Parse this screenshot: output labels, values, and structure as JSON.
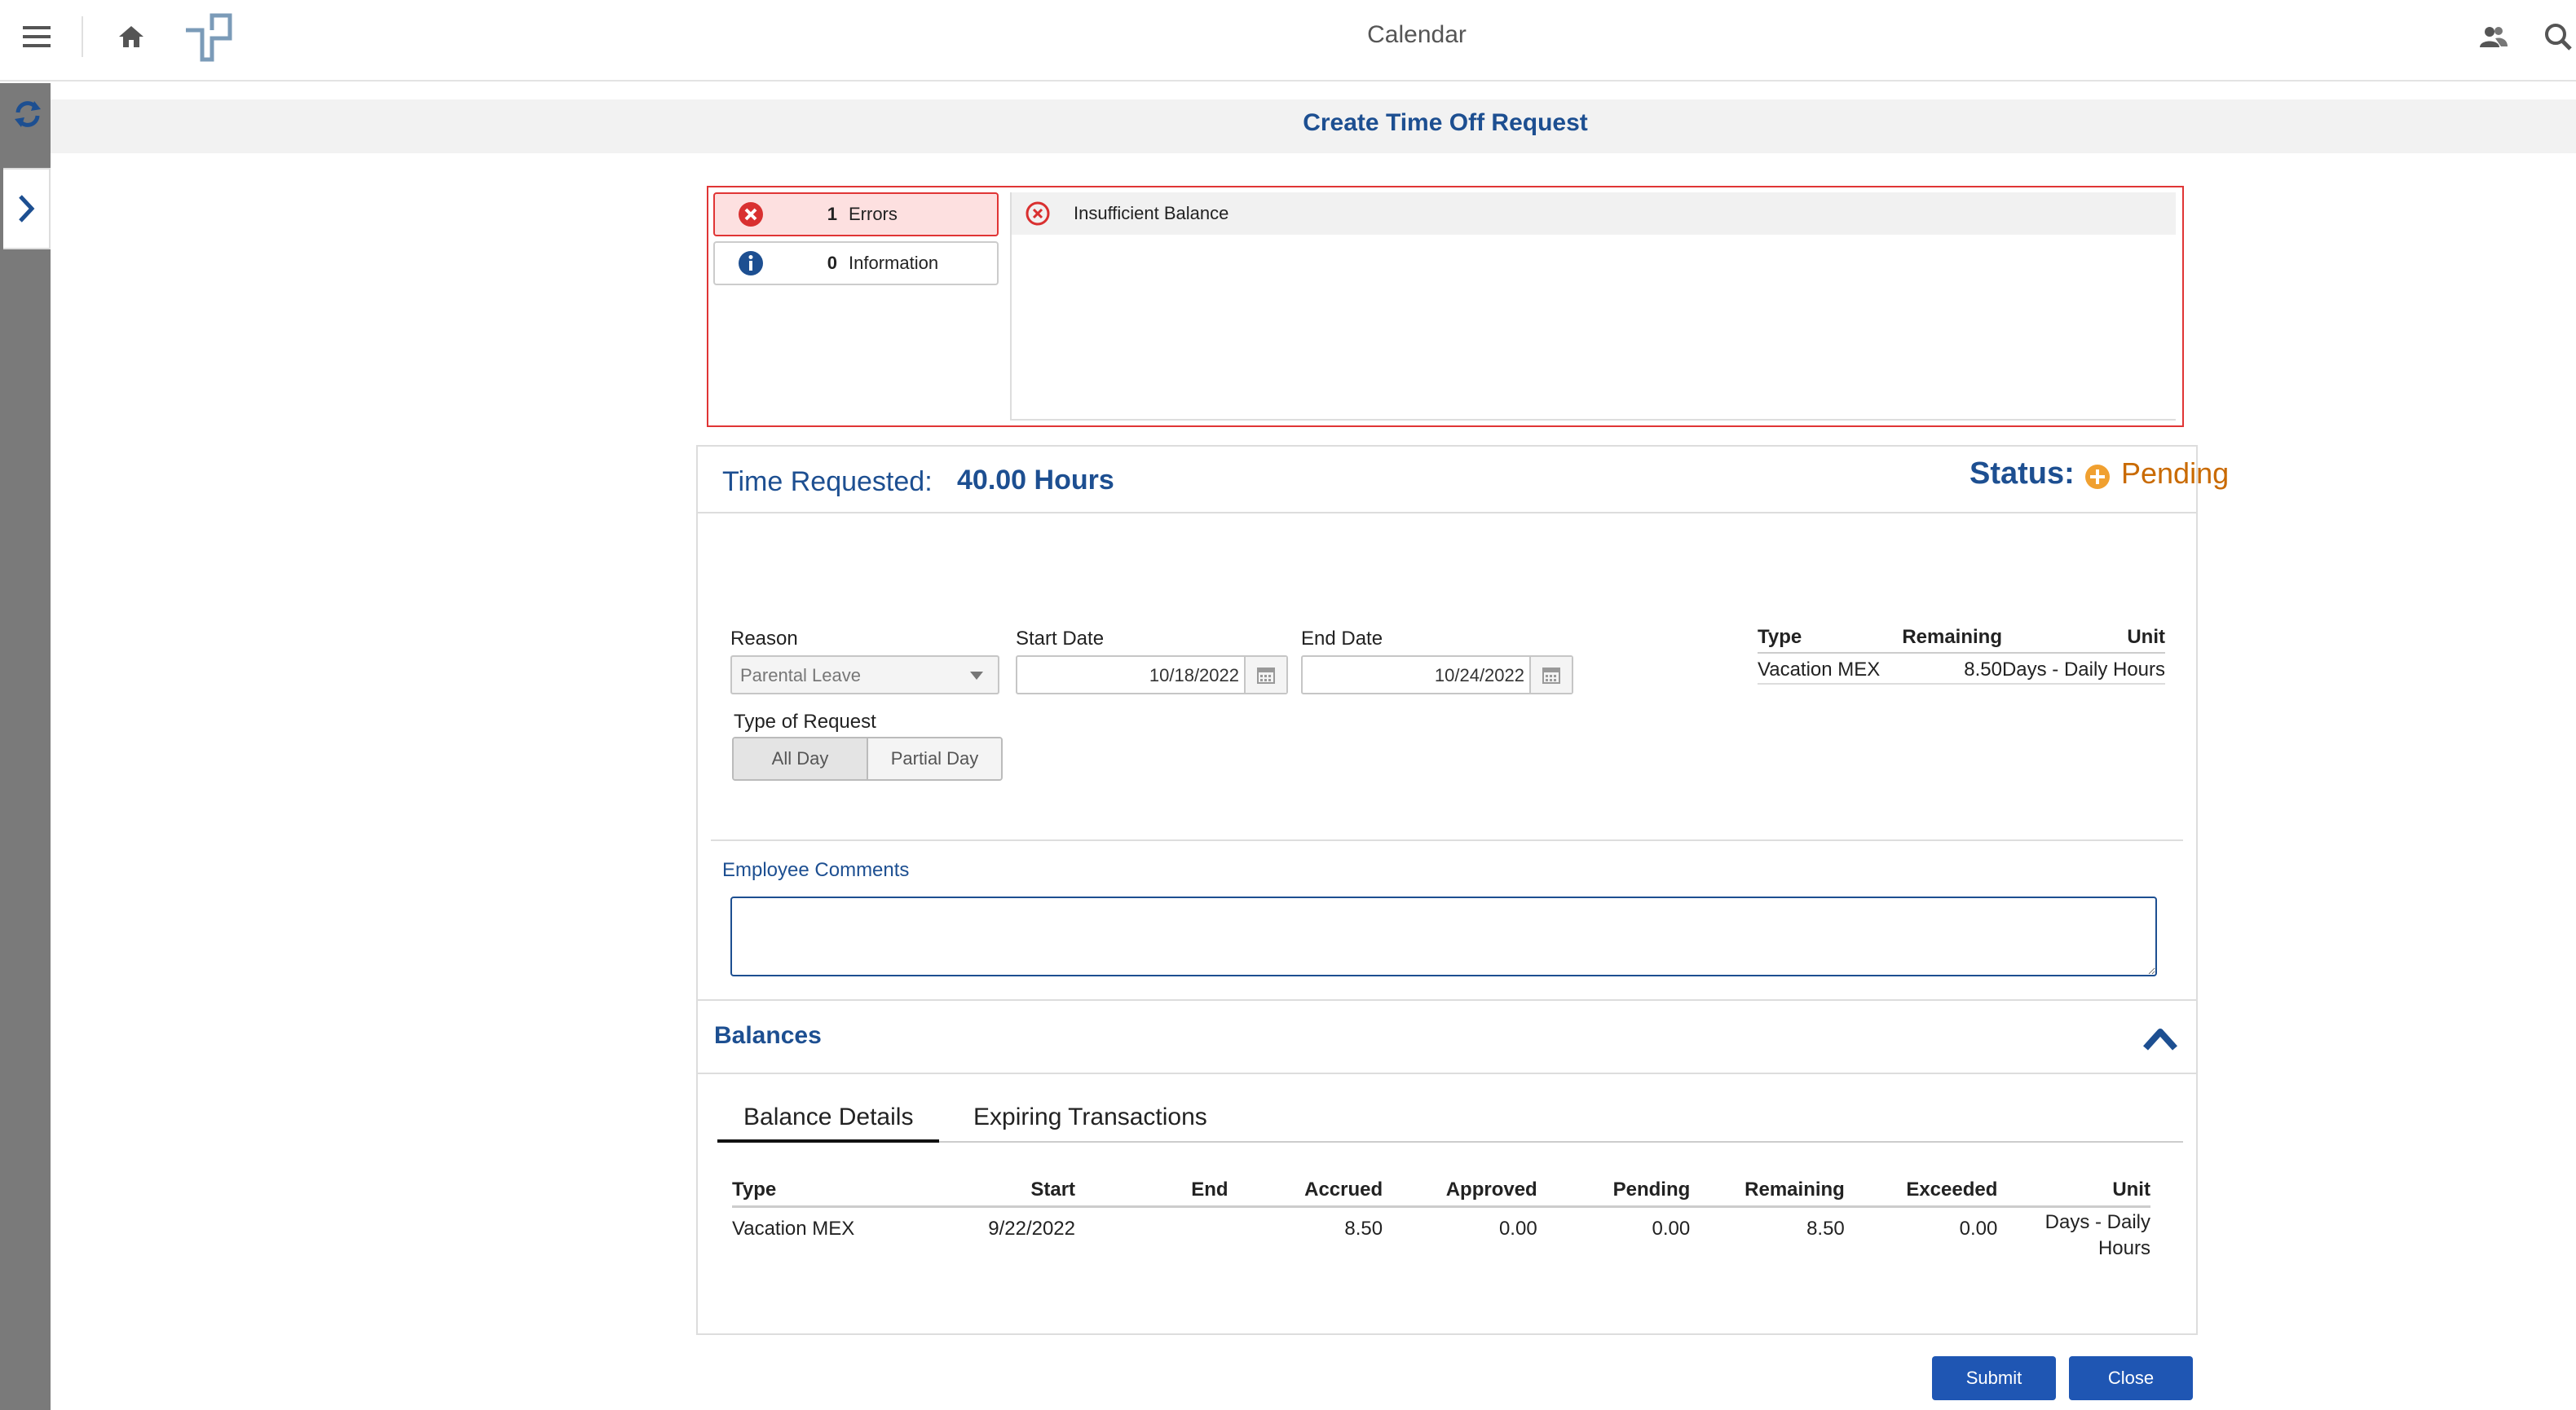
{
  "topbar": {
    "title": "Calendar"
  },
  "page": {
    "title": "Create Time Off Request"
  },
  "messages": {
    "errors_count": "1",
    "errors_label": "Errors",
    "info_count": "0",
    "info_label": "Information",
    "error_items": [
      "Insufficient Balance"
    ]
  },
  "request": {
    "time_requested_label": "Time Requested:",
    "time_requested_value": "40.00 Hours",
    "status_label": "Status:",
    "status_value": "Pending",
    "reason_label": "Reason",
    "reason_value": "Parental Leave",
    "start_label": "Start Date",
    "start_value": "10/18/2022",
    "end_label": "End Date",
    "end_value": "10/24/2022",
    "type_of_request_label": "Type of Request",
    "type_options": [
      "All Day",
      "Partial Day"
    ],
    "selected_type": "All Day"
  },
  "summary": {
    "headers": [
      "Type",
      "Remaining",
      "Unit"
    ],
    "row": {
      "type": "Vacation MEX",
      "remaining_unit": "8.50Days - Daily Hours"
    }
  },
  "comments": {
    "label": "Employee Comments",
    "value": ""
  },
  "balances": {
    "title": "Balances",
    "tabs": [
      "Balance Details",
      "Expiring Transactions"
    ],
    "active_tab": "Balance Details",
    "headers": [
      "Type",
      "Start",
      "End",
      "Accrued",
      "Approved",
      "Pending",
      "Remaining",
      "Exceeded",
      "Unit"
    ],
    "rows": [
      {
        "type": "Vacation MEX",
        "start": "9/22/2022",
        "end": "",
        "accrued": "8.50",
        "approved": "0.00",
        "pending": "0.00",
        "remaining": "8.50",
        "exceeded": "0.00",
        "unit": "Days - Daily Hours"
      }
    ]
  },
  "actions": {
    "submit": "Submit",
    "close": "Close"
  },
  "colors": {
    "accent": "#1d4f91",
    "error": "#e03535",
    "pending": "#c96a00",
    "button": "#1f56b3"
  },
  "icons": [
    "menu-icon",
    "home-icon",
    "logo-icon",
    "people-icon",
    "search-icon",
    "refresh-icon",
    "chevron-right-icon",
    "error-icon",
    "info-icon",
    "calendar-icon",
    "plus-circle-icon",
    "chevron-up-icon"
  ]
}
